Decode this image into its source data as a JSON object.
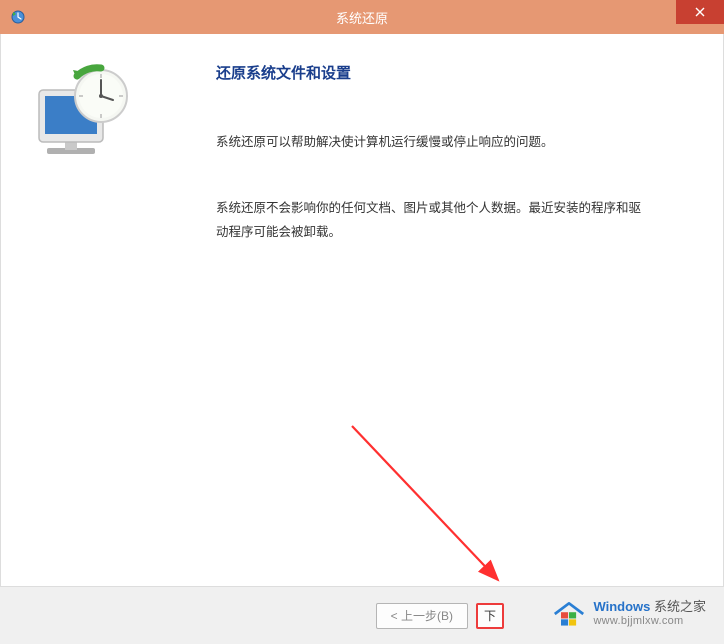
{
  "titlebar": {
    "title": "系统还原"
  },
  "content": {
    "heading": "还原系统文件和设置",
    "paragraph1": "系统还原可以帮助解决使计算机运行缓慢或停止响应的问题。",
    "paragraph2": "系统还原不会影响你的任何文档、图片或其他个人数据。最近安装的程序和驱动程序可能会被卸载。"
  },
  "footer": {
    "back_label": "< 上一步(B)",
    "next_partial": "下"
  },
  "watermark": {
    "brand_prefix": "Windows",
    "brand_suffix": " 系统之家",
    "url": "www.bjjmlxw.com"
  }
}
